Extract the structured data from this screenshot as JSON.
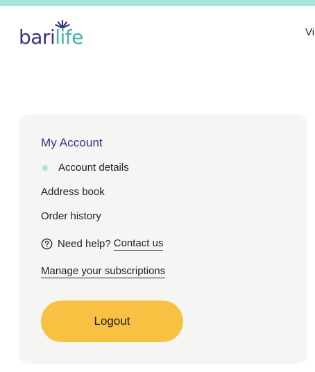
{
  "header": {
    "logo": {
      "part_a": "bari",
      "part_b": "life"
    },
    "nav_partial": "Vi"
  },
  "account_menu": {
    "title": "My Account",
    "items": [
      {
        "label": "Account details",
        "active": true
      },
      {
        "label": "Address book",
        "active": false
      },
      {
        "label": "Order history",
        "active": false
      }
    ],
    "help_text": "Need help?",
    "contact_label": "Contact us",
    "subscriptions_label": "Manage your subscriptions",
    "logout_label": "Logout"
  },
  "colors": {
    "top_bar": "#a8e4d9",
    "brand_purple": "#3a2f84",
    "brand_teal": "#3fb7a6",
    "card_background": "#f5f5f3",
    "logout_button": "#f9c142"
  },
  "icons": {
    "help": "question-circle-icon",
    "active_indicator": "dot"
  }
}
